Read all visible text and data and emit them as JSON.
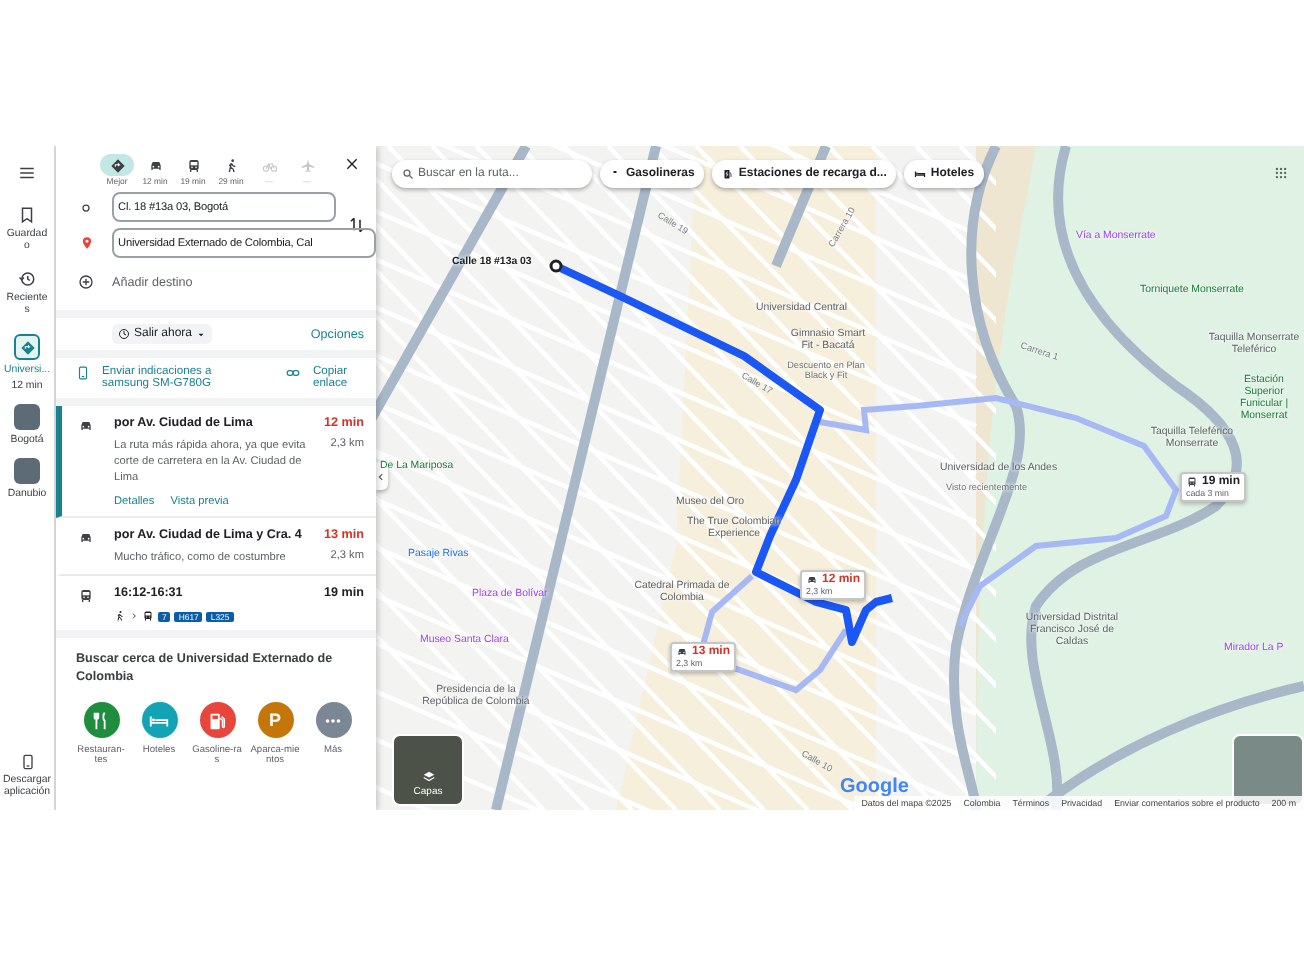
{
  "rail": {
    "items": [
      {
        "kind": "saved",
        "label": "Guardado"
      },
      {
        "kind": "recent",
        "label": "Recientes"
      }
    ],
    "places": [
      {
        "kind": "route",
        "label": "Universi...",
        "sub": "12 min",
        "selected": true
      },
      {
        "kind": "photo",
        "label": "Bogotá",
        "selected": false
      },
      {
        "kind": "photo",
        "label": "Danubio",
        "selected": false
      }
    ],
    "download": "Descargar aplicación"
  },
  "directions": {
    "modes": [
      {
        "kind": "best",
        "label": "Mejor",
        "selected": true,
        "disabled": false
      },
      {
        "kind": "car",
        "label": "12 min",
        "selected": false,
        "disabled": false
      },
      {
        "kind": "transit",
        "label": "19 min",
        "selected": false,
        "disabled": false
      },
      {
        "kind": "walk",
        "label": "29 min",
        "selected": false,
        "disabled": false
      },
      {
        "kind": "bike",
        "label": "—",
        "selected": false,
        "disabled": true
      },
      {
        "kind": "plane",
        "label": "—",
        "selected": false,
        "disabled": true
      }
    ],
    "origin": "Cl. 18 #13a 03, Bogotá",
    "destination": "Universidad Externado de Colombia, Cal",
    "add_destination": "Añadir destino",
    "depart": "Salir ahora",
    "options": "Opciones",
    "send": "Enviar indicaciones a samsung SM-G780G",
    "copy_link": "Copiar enlace"
  },
  "routes": [
    {
      "kind": "car",
      "title": "por Av. Ciudad de Lima",
      "time": "12 min",
      "color": "#d93025",
      "distance": "2,3 km",
      "description": "La ruta más rápida ahora, ya que evita corte de carretera en la Av. Ciudad de Lima",
      "links": [
        "Detalles",
        "Vista previa"
      ],
      "selected": true
    },
    {
      "kind": "car",
      "title": "por Av. Ciudad de Lima y Cra. 4",
      "time": "13 min",
      "color": "#d93025",
      "distance": "2,3 km",
      "description": "Mucho tráfico, como de costumbre",
      "selected": false
    },
    {
      "kind": "transit",
      "title": "16:12-16:31",
      "time": "19 min",
      "color": "#202124",
      "lines": [
        "7",
        "H617",
        "L325"
      ],
      "selected": false
    }
  ],
  "nearby": {
    "title": "Buscar cerca de Universidad Externado de Colombia",
    "categories": [
      {
        "kind": "restaurant",
        "label": "Restauran-tes",
        "color": "#1e8e3e"
      },
      {
        "kind": "hotel",
        "label": "Hoteles",
        "color": "#12a4b4"
      },
      {
        "kind": "fuel",
        "label": "Gasoline-ras",
        "color": "#e8453c"
      },
      {
        "kind": "parking",
        "label": "Aparca-mientos",
        "symbol": "P",
        "color": "#c5760a"
      },
      {
        "kind": "more",
        "label": "Más",
        "color": "#7b8794"
      }
    ]
  },
  "map": {
    "search_placeholder": "Buscar en la ruta...",
    "chips": [
      {
        "kind": "fuel",
        "label": "Gasolineras"
      },
      {
        "kind": "charger",
        "label": "Estaciones de recarga d..."
      },
      {
        "kind": "hotel",
        "label": "Hoteles"
      }
    ],
    "labels": [
      {
        "kind": "start",
        "text": "Calle 18 #13a 03"
      },
      {
        "kind": "place",
        "text": "Universidad Central"
      },
      {
        "kind": "place",
        "text": "Gimnasio Smart Fit - Bacatá"
      },
      {
        "kind": "note",
        "text": "Descuento en Plan Black y Fit"
      },
      {
        "kind": "poi",
        "text": "Vía a Monserrate"
      },
      {
        "kind": "park",
        "text": "Torniquete Monserrate"
      },
      {
        "kind": "place",
        "text": "Taquilla Monserrate Teleférico"
      },
      {
        "kind": "park",
        "text": "Estación Superior Funicular | Monserrat"
      },
      {
        "kind": "place",
        "text": "Taquilla Teleférico Monserrate"
      },
      {
        "kind": "place",
        "text": "Universidad de los Andes"
      },
      {
        "kind": "note",
        "text": "Visto recientemente"
      },
      {
        "kind": "place",
        "text": "Museo del Oro"
      },
      {
        "kind": "place",
        "text": "The True Colombian Experience"
      },
      {
        "kind": "park",
        "text": "De La Mariposa"
      },
      {
        "kind": "shop",
        "text": "Pasaje Rivas"
      },
      {
        "kind": "poi",
        "text": "Plaza de Bolívar"
      },
      {
        "kind": "place",
        "text": "Catedral Primada de Colombia"
      },
      {
        "kind": "poi",
        "text": "Museo Santa Clara"
      },
      {
        "kind": "place",
        "text": "Presidencia de la República de Colombia"
      },
      {
        "kind": "place",
        "text": "Universidad Distrital Francisco José de Caldas"
      },
      {
        "kind": "poi",
        "text": "Mirador La P"
      },
      {
        "kind": "street",
        "text": "Calle 19"
      },
      {
        "kind": "street",
        "text": "Carrera 10"
      },
      {
        "kind": "street",
        "text": "Calle 17"
      },
      {
        "kind": "street",
        "text": "Carrera 1"
      },
      {
        "kind": "street",
        "text": "Calle 10"
      }
    ],
    "callouts": [
      {
        "kind": "car",
        "time": "12 min",
        "sub": "2,3 km",
        "color": "#d93025"
      },
      {
        "kind": "car",
        "time": "13 min",
        "sub": "2,3 km",
        "color": "#d93025"
      },
      {
        "kind": "transit",
        "time": "19 min",
        "sub": "cada 3 min",
        "color": "#202124"
      }
    ],
    "layers": "Capas",
    "logo": "Google",
    "attribution": [
      "Datos del mapa ©2025",
      "Colombia",
      "Términos",
      "Privacidad",
      "Enviar comentarios sobre el producto",
      "200 m"
    ]
  }
}
